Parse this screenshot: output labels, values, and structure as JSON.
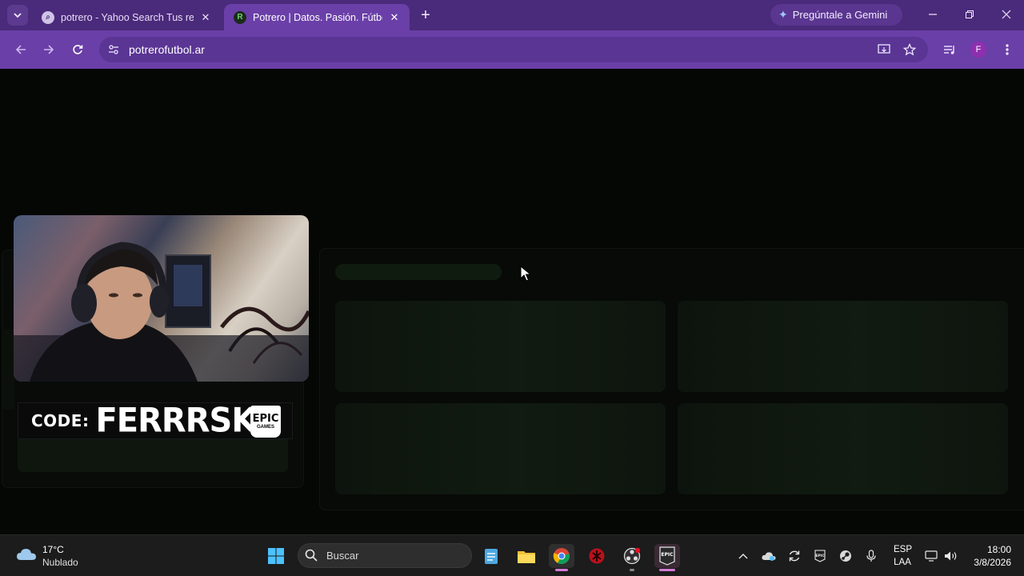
{
  "browser": {
    "tabs": [
      {
        "title": "potrero - Yahoo Search Tus resultados",
        "favicon": "yahoo-search-favicon",
        "active": false
      },
      {
        "title": "Potrero | Datos. Pasión. Fútbol.",
        "favicon": "potrero-favicon",
        "active": true
      }
    ],
    "tab_close_glyph": "✕",
    "new_tab_glyph": "+",
    "gemini_label": "Pregúntale a Gemini",
    "address": "potrerofutbol.ar",
    "profile_initial": "F",
    "accent": "#6a3fa8"
  },
  "overlay": {
    "code_label": "CODE:",
    "code_value": "FERRRSKR",
    "logo_top": "EPIC",
    "logo_bottom": "GAMES"
  },
  "taskbar": {
    "weather_temp": "17°C",
    "weather_desc": "Nublado",
    "search_placeholder": "Buscar",
    "lang_top": "ESP",
    "lang_bottom": "LAA",
    "time": "18:00",
    "date": "3/8/2026",
    "apps": [
      "start-icon",
      "search-icon",
      "notepad-icon",
      "file-explorer-icon",
      "chrome-icon",
      "app-icon",
      "obs-icon",
      "epic-games-icon"
    ]
  }
}
